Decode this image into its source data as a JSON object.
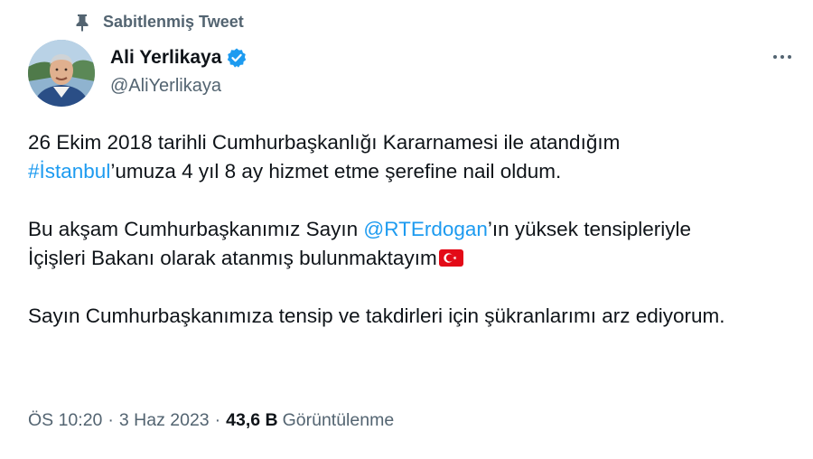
{
  "pinned": {
    "label": "Sabitlenmiş Tweet",
    "icon": "pin-icon"
  },
  "author": {
    "display_name": "Ali Yerlikaya",
    "handle": "@AliYerlikaya",
    "verified_icon": "verified-badge-icon",
    "verified_color": "#1d9bf0"
  },
  "more_icon": "more-options-icon",
  "tweet": {
    "p1_line1": "26 Ekim 2018 tarihli Cumhurbaşkanlığı Kararnamesi ile atandığım",
    "p1_hashtag": "#İstanbul",
    "p1_rest": "’umuza 4 yıl 8 ay hizmet etme şerefine nail oldum.",
    "p2_start": "Bu akşam Cumhurbaşkanımız Sayın ",
    "p2_mention": "@RTErdogan",
    "p2_rest": "’ın yüksek tensipleriyle",
    "p2_line2": "İçişleri Bakanı olarak atanmış bulunmaktayım",
    "p2_emoji": "turkey-flag-icon",
    "p3": "Sayın Cumhurbaşkanımıza tensip ve takdirleri için şükranlarımı arz ediyorum."
  },
  "meta": {
    "time": "ÖS 10:20",
    "separator": "·",
    "date": "3 Haz 2023",
    "views_count": "43,6 B",
    "views_label": "Görüntülenme"
  },
  "colors": {
    "link": "#1d9bf0",
    "text": "#0f1419",
    "muted": "#536471"
  }
}
